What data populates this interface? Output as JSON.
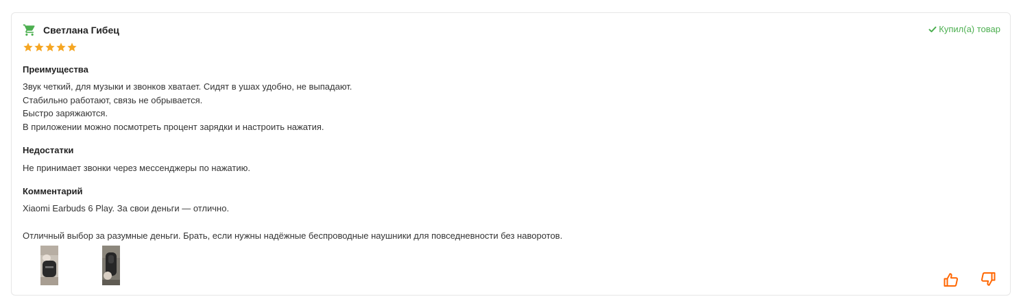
{
  "review": {
    "author": "Светлана Гибец",
    "purchased_label": "Купил(а) товар",
    "rating": 5,
    "rating_max": 5,
    "sections": {
      "pros_title": "Преимущества",
      "pros_text": "Звук четкий, для музыки и звонков хватает. Сидят в ушах удобно, не выпадают.\nСтабильно работают, связь не обрывается.\nБыстро заряжаются.\nВ приложении можно посмотреть процент зарядки и настроить нажатия.",
      "cons_title": "Недостатки",
      "cons_text": "Не принимает звонки через мессенджеры по нажатию.",
      "comment_title": "Комментарий",
      "comment_line1": "Xiaomi Earbuds 6 Play. За свои деньги — отлично.",
      "comment_line2": "Отличный выбор за разумные деньги. Брать, если нужны надёжные беспроводные наушники для повседневности без наворотов."
    },
    "photos_count": 2
  },
  "icons": {
    "cart": "shopping-cart-icon",
    "check": "checkmark-icon",
    "star": "star-icon",
    "like": "thumbs-up-icon",
    "dislike": "thumbs-down-icon"
  },
  "colors": {
    "cart_green": "#4caf50",
    "purchased_green": "#4caf50",
    "star_orange": "#f5a623",
    "vote_orange": "#ff6600",
    "border": "#e6e6e6"
  }
}
